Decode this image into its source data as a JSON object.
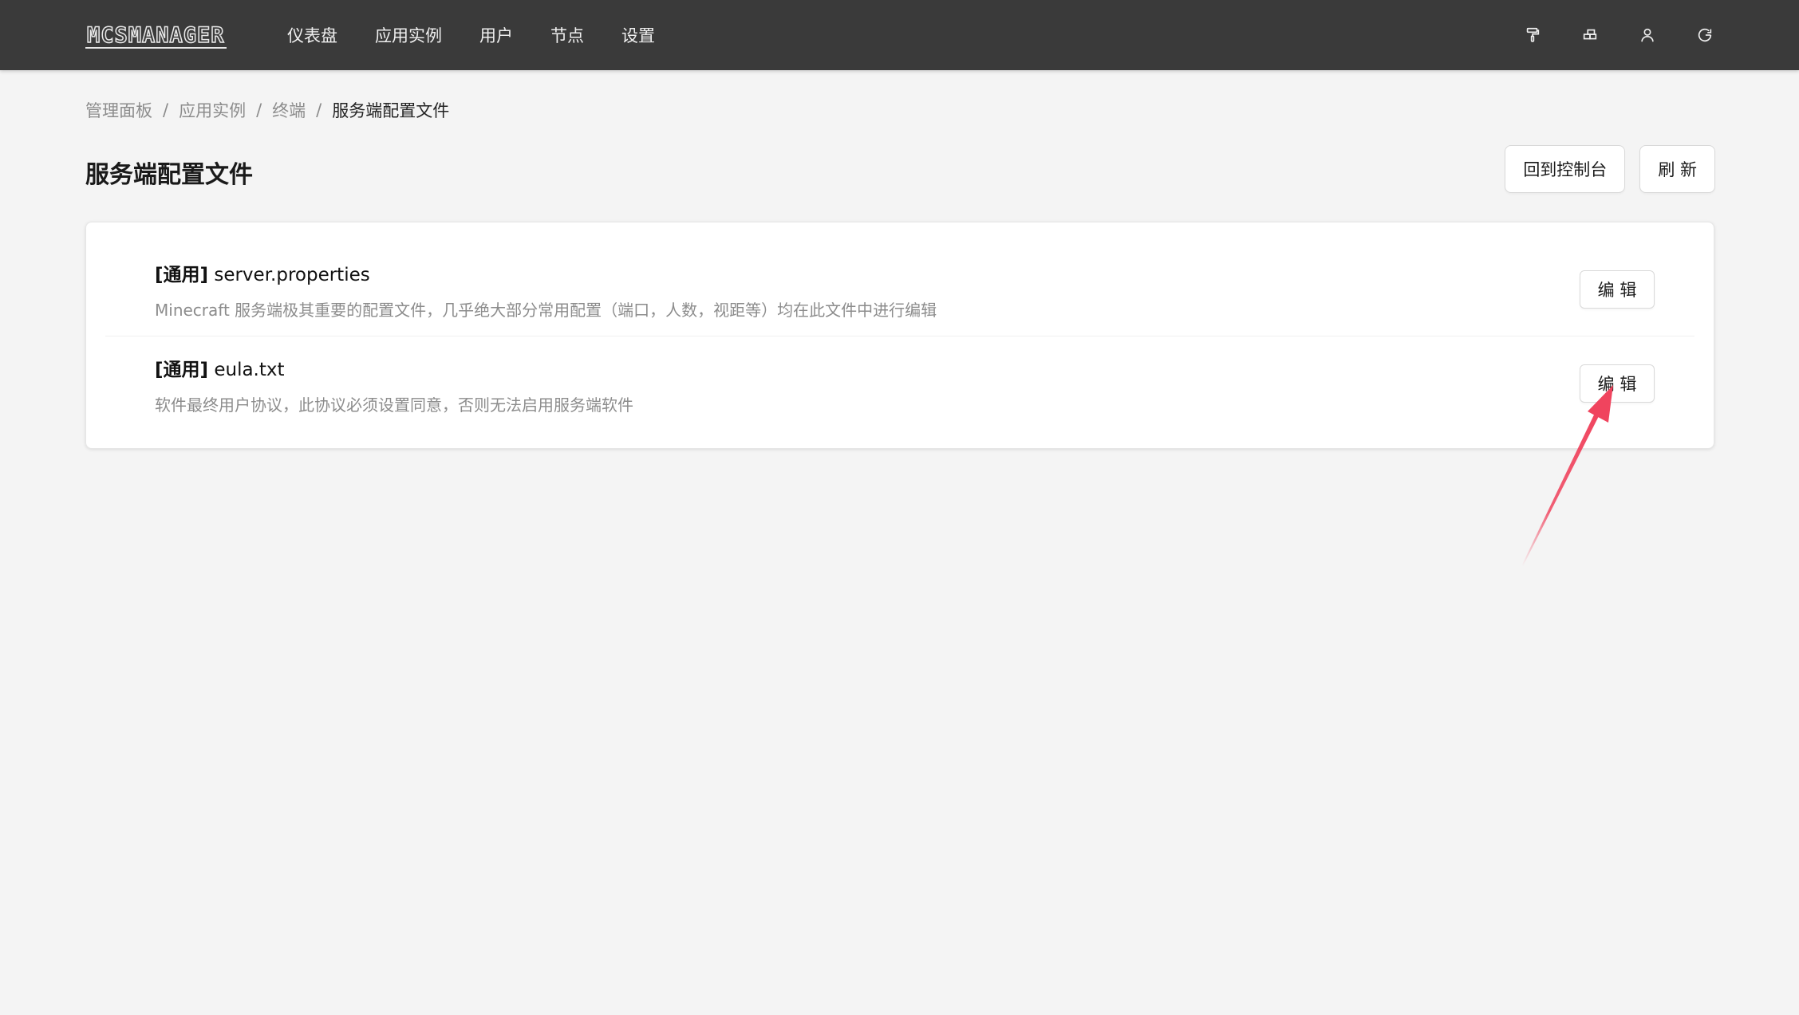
{
  "app": {
    "logo_text": "MCSMANAGER"
  },
  "nav": {
    "items": [
      {
        "label": "仪表盘"
      },
      {
        "label": "应用实例"
      },
      {
        "label": "用户"
      },
      {
        "label": "节点"
      },
      {
        "label": "设置"
      }
    ],
    "icons": [
      "paint-roller-icon",
      "grid-icon",
      "user-icon",
      "refresh-icon"
    ]
  },
  "breadcrumb": {
    "items": [
      "管理面板",
      "应用实例",
      "终端"
    ],
    "current": "服务端配置文件",
    "separator": "/"
  },
  "header": {
    "title": "服务端配置文件",
    "back_button": "回到控制台",
    "refresh_button": "刷 新"
  },
  "files": [
    {
      "tag": "[通用]",
      "name": "server.properties",
      "description": "Minecraft 服务端极其重要的配置文件，几乎绝大部分常用配置（端口，人数，视距等）均在此文件中进行编辑",
      "edit_label": "编 辑"
    },
    {
      "tag": "[通用]",
      "name": "eula.txt",
      "description": "软件最终用户协议，此协议必须设置同意，否则无法启用服务端软件",
      "edit_label": "编 辑"
    }
  ],
  "colors": {
    "topbar": "#3a3a3a",
    "background": "#f4f4f4",
    "annotation_arrow": "#f0445e"
  }
}
